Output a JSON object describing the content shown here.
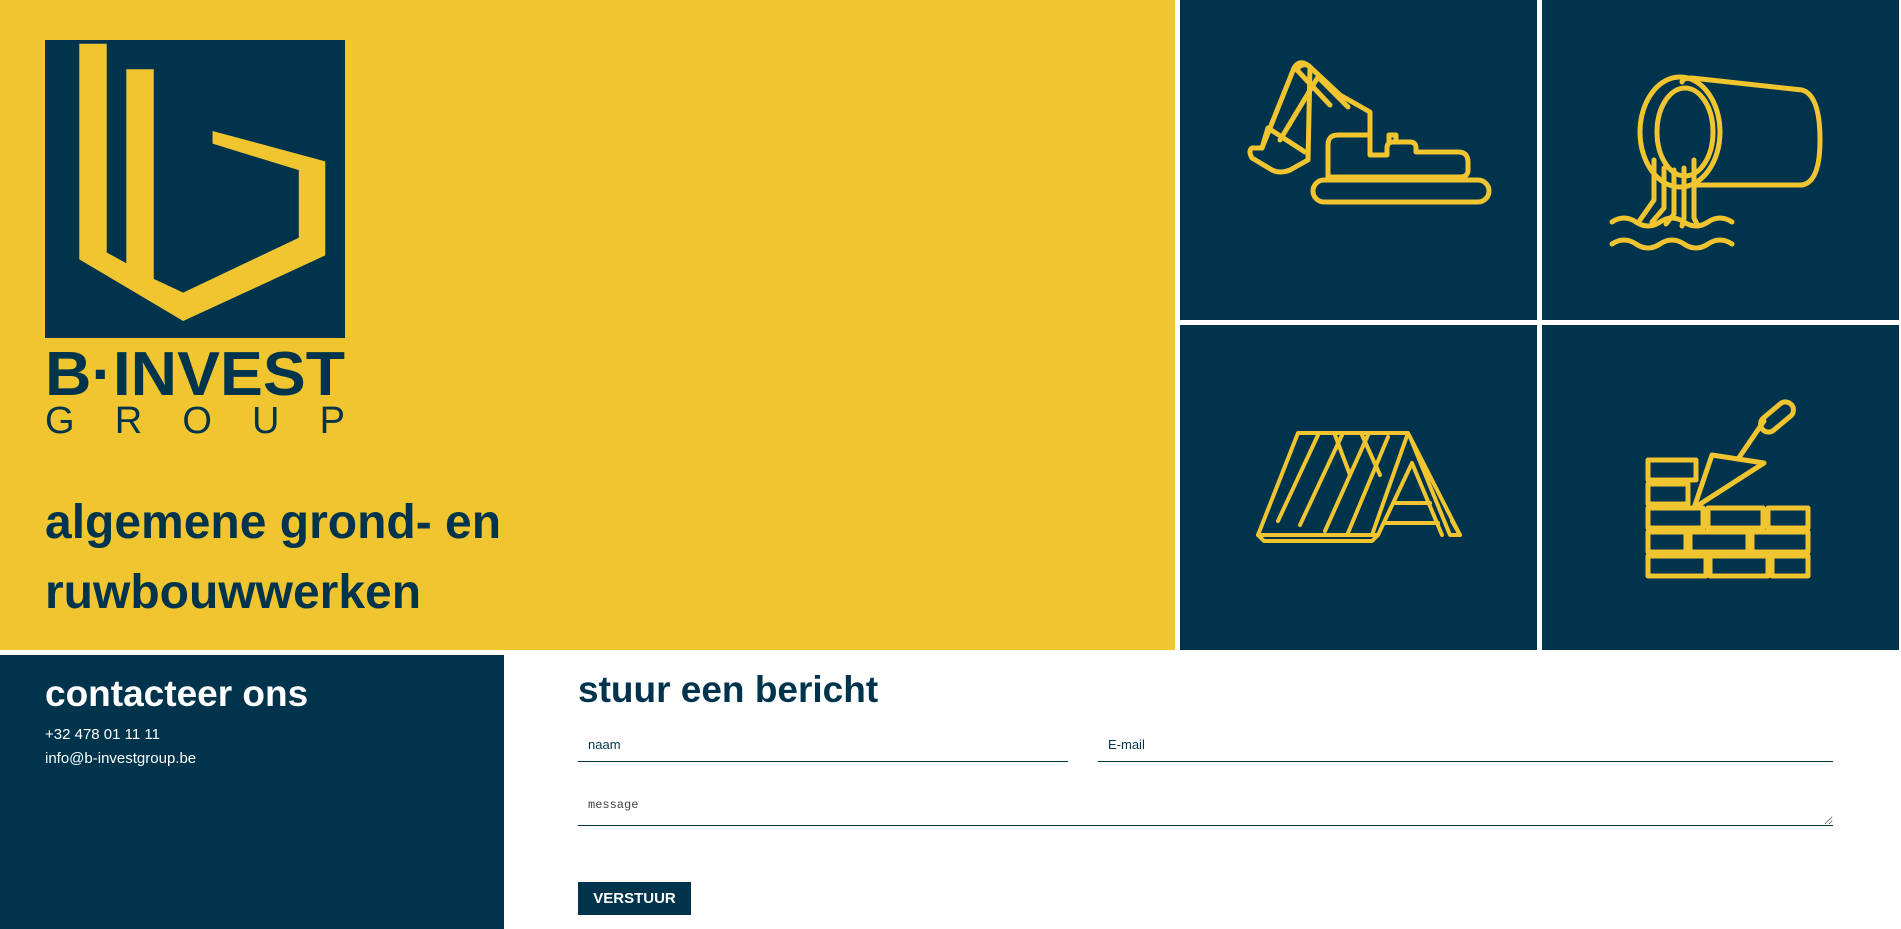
{
  "brand": {
    "name": "B·INVEST",
    "group": "GROUP",
    "primary_color": "#00344d",
    "accent_color": "#f0c530"
  },
  "hero": {
    "tagline_line1": "algemene grond- en",
    "tagline_line2": "ruwbouwwerken"
  },
  "services": {
    "tiles": [
      {
        "icon": "excavator-icon"
      },
      {
        "icon": "drain-pipe-icon"
      },
      {
        "icon": "roof-truss-icon"
      },
      {
        "icon": "trowel-bricks-icon"
      }
    ]
  },
  "contact": {
    "title": "contacteer ons",
    "phone": "+32 478 01 11 11",
    "email": "info@b-investgroup.be"
  },
  "form": {
    "title": "stuur een bericht",
    "name_placeholder": "naam",
    "name_value": "",
    "email_placeholder": "E-mail",
    "email_value": "",
    "message_placeholder": "message",
    "message_value": "",
    "submit_label": "VERSTUUR"
  }
}
